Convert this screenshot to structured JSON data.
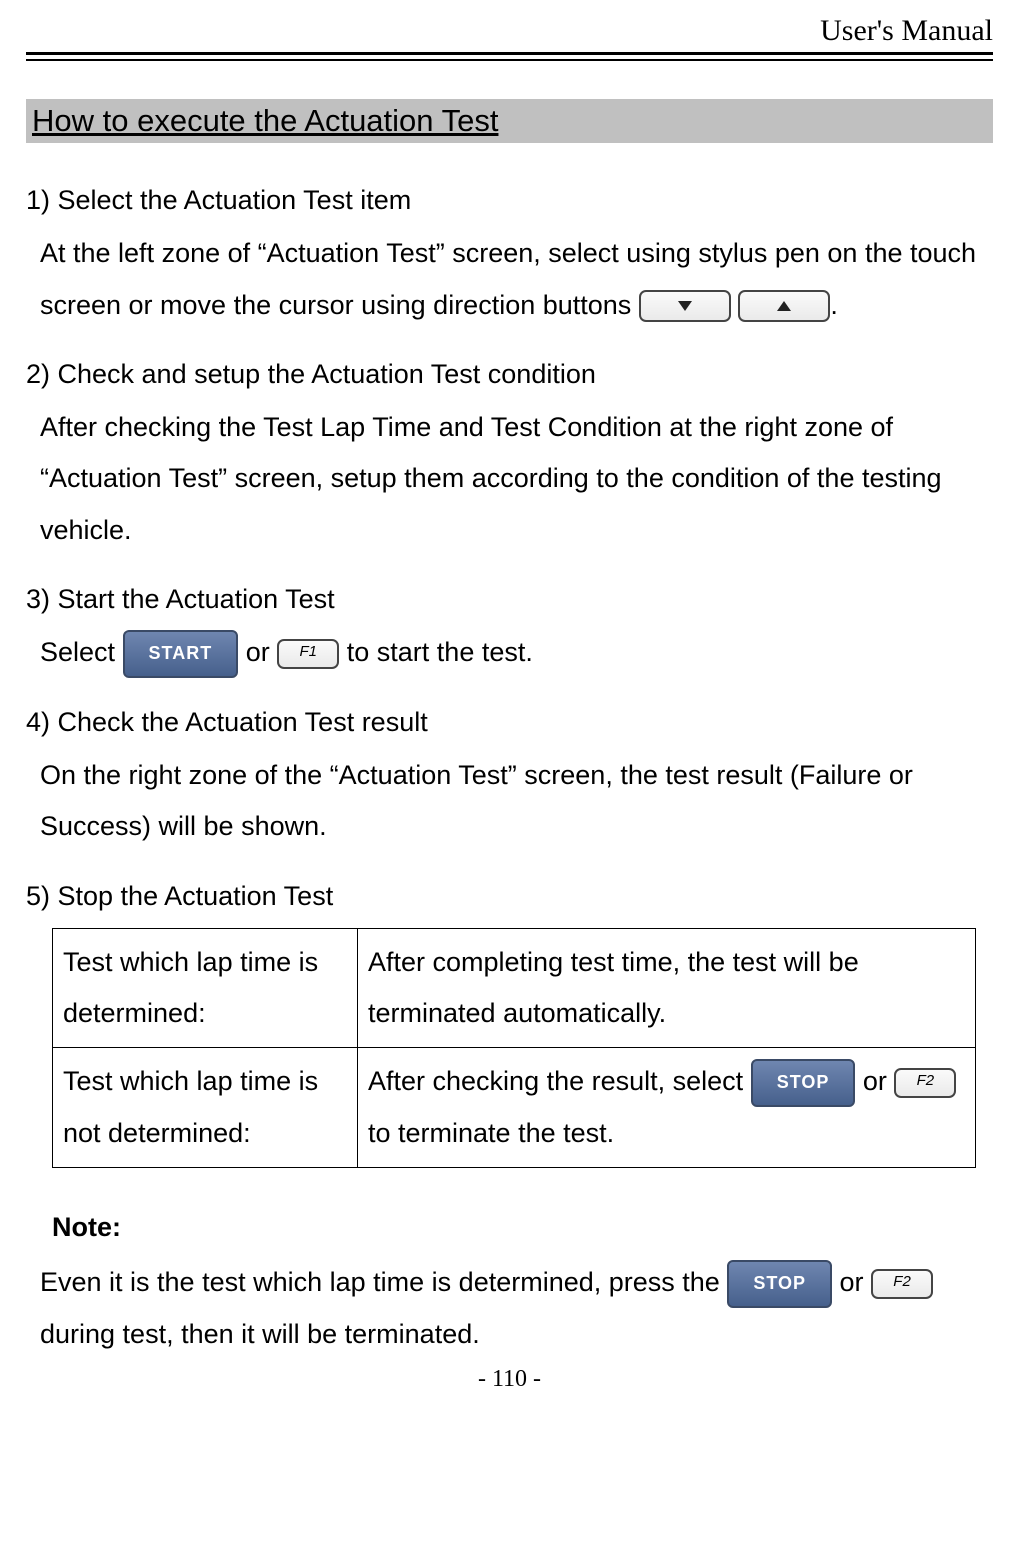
{
  "header": "User's Manual",
  "section_title": "How to execute the Actuation Test",
  "steps": {
    "s1_head": "1) Select the Actuation Test item",
    "s1_body_a": "At the left zone of “Actuation Test” screen, select using stylus pen on the touch screen or move the cursor using direction buttons ",
    "s1_body_b": ".",
    "s2_head": "2) Check and setup the Actuation Test condition",
    "s2_body": "After checking the Test Lap Time and Test Condition at the right zone of “Actuation Test” screen, setup them according to the condition of the testing vehicle.",
    "s3_head": "3) Start the Actuation Test",
    "s3_body_a": "Select ",
    "s3_body_b": " or ",
    "s3_body_c": " to start the test.",
    "s4_head": "4) Check the Actuation Test result",
    "s4_body": "On the right zone of the “Actuation Test” screen, the test result (Failure or Success) will be shown.",
    "s5_head": "5) Stop the Actuation Test"
  },
  "table": {
    "row1_left": "Test which lap time is determined:",
    "row1_right": "After completing test time, the test will be terminated automatically.",
    "row2_left": "Test which lap time is not determined:",
    "row2_right_a": "After checking the result, select ",
    "row2_right_b": " or  ",
    "row2_right_c": " to terminate the test."
  },
  "note": {
    "head": "Note:",
    "body_a": "Even it is the test which lap time is determined, press the ",
    "body_b": " or ",
    "body_c": " during test, then it will be terminated."
  },
  "buttons": {
    "start": "START",
    "stop": "STOP",
    "f1": "F1",
    "f2": "F2"
  },
  "footer": "- 110 -"
}
